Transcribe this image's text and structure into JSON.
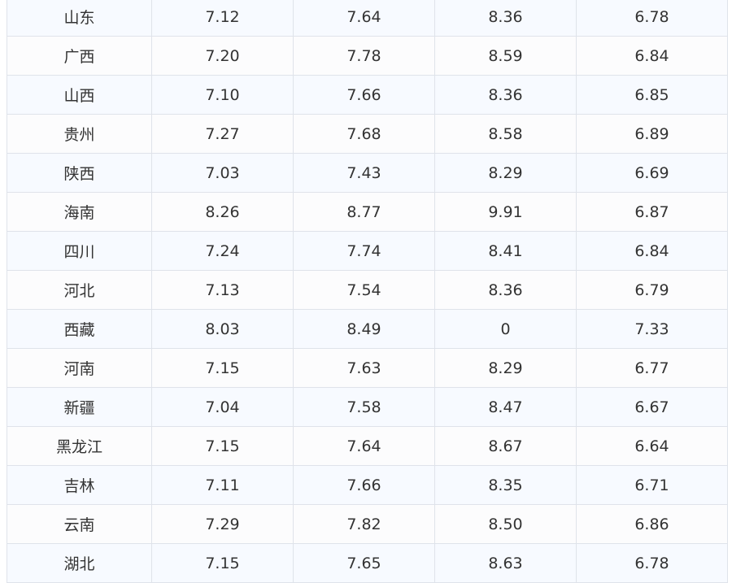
{
  "table": {
    "rows": [
      [
        "山东",
        "7.12",
        "7.64",
        "8.36",
        "6.78"
      ],
      [
        "广西",
        "7.20",
        "7.78",
        "8.59",
        "6.84"
      ],
      [
        "山西",
        "7.10",
        "7.66",
        "8.36",
        "6.85"
      ],
      [
        "贵州",
        "7.27",
        "7.68",
        "8.58",
        "6.89"
      ],
      [
        "陕西",
        "7.03",
        "7.43",
        "8.29",
        "6.69"
      ],
      [
        "海南",
        "8.26",
        "8.77",
        "9.91",
        "6.87"
      ],
      [
        "四川",
        "7.24",
        "7.74",
        "8.41",
        "6.84"
      ],
      [
        "河北",
        "7.13",
        "7.54",
        "8.36",
        "6.79"
      ],
      [
        "西藏",
        "8.03",
        "8.49",
        "0",
        "7.33"
      ],
      [
        "河南",
        "7.15",
        "7.63",
        "8.29",
        "6.77"
      ],
      [
        "新疆",
        "7.04",
        "7.58",
        "8.47",
        "6.67"
      ],
      [
        "黑龙江",
        "7.15",
        "7.64",
        "8.67",
        "6.64"
      ],
      [
        "吉林",
        "7.11",
        "7.66",
        "8.35",
        "6.71"
      ],
      [
        "云南",
        "7.29",
        "7.82",
        "8.50",
        "6.86"
      ],
      [
        "湖北",
        "7.15",
        "7.65",
        "8.63",
        "6.78"
      ]
    ]
  }
}
